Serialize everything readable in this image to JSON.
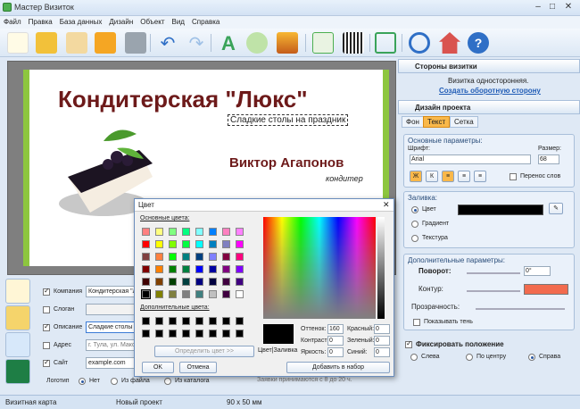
{
  "window": {
    "title": "Мастер Визиток"
  },
  "menu": [
    "Файл",
    "Правка",
    "База данных",
    "Дизайн",
    "Объект",
    "Вид",
    "Справка"
  ],
  "card": {
    "title": "Кондитерская \"Люкс\"",
    "subtitle": "Сладкие столы на праздник",
    "name": "Виктор Агапонов",
    "role": "кондитер"
  },
  "fields": {
    "company": {
      "label": "Компания",
      "value": "Кондитерская \"Л"
    },
    "slogan": {
      "label": "Слоган",
      "value": ""
    },
    "description": {
      "label": "Описание",
      "value": "Сладкие столы н"
    },
    "address": {
      "label": "Адрес",
      "value": "г. Тула, ул. Мако"
    },
    "site": {
      "label": "Сайт",
      "value": "example.com"
    },
    "logo": {
      "label": "Логотип",
      "none": "Нет",
      "fromfile": "Из файла",
      "fromcatalog": "Из каталога"
    },
    "note": "Заявки принимаются с 8 до 20 ч."
  },
  "right": {
    "sides_title": "Стороны визитки",
    "sides_text": "Визитка односторонняя.",
    "sides_link": "Создать оборотную сторону",
    "design_title": "Дизайн проекта",
    "tabs": [
      "Фон",
      "Текст",
      "Сетка"
    ],
    "basic": "Основные параметры:",
    "font_label": "Шрифт:",
    "font": "Arial",
    "size_label": "Размер:",
    "size": "68",
    "wrap": "Перенос слов",
    "fill": "Заливка:",
    "fill_color": "Цвет",
    "fill_gradient": "Градиент",
    "fill_texture": "Текстура",
    "extra": "Дополнительные параметры:",
    "rotation": "Поворот:",
    "rotation_val": "0°",
    "outline": "Контур:",
    "transparency": "Прозрачность:",
    "shadow": "Показывать тень",
    "fix": "Фиксировать положение",
    "left": "Слева",
    "center": "По центру",
    "rightpos": "Справа"
  },
  "dialog": {
    "title": "Цвет",
    "basic": "Основные цвета:",
    "custom": "Дополнительные цвета:",
    "define": "Определить цвет >>",
    "ok": "OK",
    "cancel": "Отмена",
    "hue": "Оттенок:",
    "sat": "Контраст:",
    "lum": "Яркость:",
    "red": "Красный:",
    "green": "Зеленый:",
    "blue": "Синий:",
    "hue_v": "160",
    "sat_v": "0",
    "lum_v": "0",
    "red_v": "0",
    "green_v": "0",
    "blue_v": "0",
    "solid": "Цвет|Заливка",
    "add": "Добавить в набор"
  },
  "status": [
    "Визитная карта",
    "Новый проект",
    "90 x 50 мм"
  ],
  "colors": {
    "accent": "#8dc63f",
    "title": "#6d1a1a",
    "contour": "#f26b4e"
  }
}
